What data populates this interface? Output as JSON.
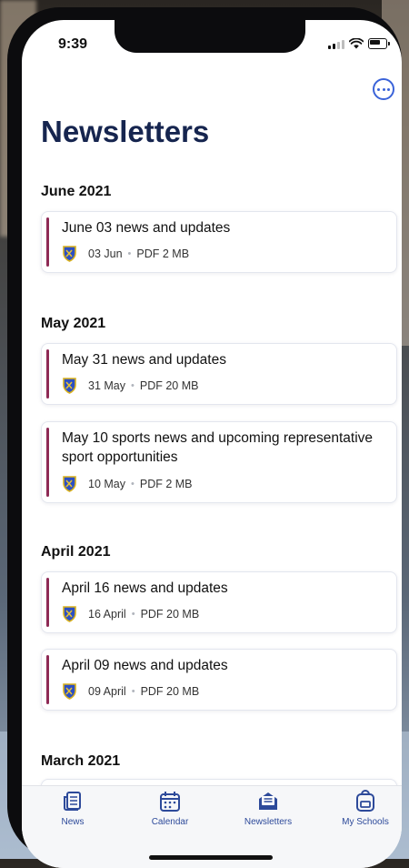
{
  "status": {
    "time": "9:39"
  },
  "header": {
    "title": "Newsletters"
  },
  "sections": [
    {
      "month": "June 2021",
      "items": [
        {
          "title": "June 03 news and updates",
          "date": "03 Jun",
          "info": "PDF 2 MB"
        }
      ]
    },
    {
      "month": "May 2021",
      "items": [
        {
          "title": "May 31 news and updates",
          "date": "31 May",
          "info": "PDF 20 MB"
        },
        {
          "title": "May 10 sports news and upcoming representative sport opportunities",
          "date": "10 May",
          "info": "PDF 2 MB"
        }
      ]
    },
    {
      "month": "April 2021",
      "items": [
        {
          "title": "April 16 news and updates",
          "date": "16 April",
          "info": "PDF 20 MB"
        },
        {
          "title": "April 09 news and updates",
          "date": "09 April",
          "info": "PDF 20 MB"
        }
      ]
    },
    {
      "month": "March 2021",
      "items": []
    }
  ],
  "tabs": [
    {
      "label": "News",
      "icon": "news-icon"
    },
    {
      "label": "Calendar",
      "icon": "calendar-icon"
    },
    {
      "label": "Newsletters",
      "icon": "newsletter-icon",
      "active": true
    },
    {
      "label": "My Schools",
      "icon": "school-bag-icon"
    }
  ],
  "colors": {
    "accent_bar": "#8e2a55",
    "title": "#16254f",
    "tab_blue": "#2d4a9a",
    "more_button": "#3a63d9"
  }
}
